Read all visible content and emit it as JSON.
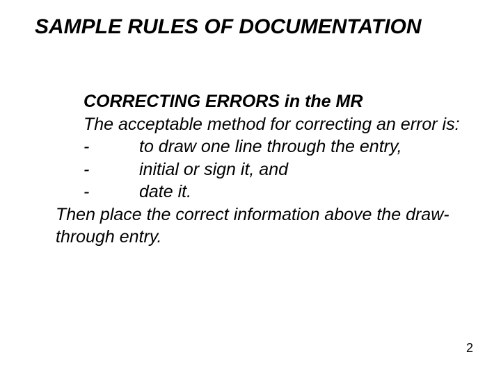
{
  "title": "SAMPLE RULES OF DOCUMENTATION",
  "subheading": "CORRECTING  ERRORS in the MR",
  "intro": "The acceptable method for correcting an error is:",
  "bullets": [
    " to draw one line through the entry,",
    "initial or sign it, and",
    "date it."
  ],
  "dash": "-",
  "closing": "Then place the correct information above the draw-through entry.",
  "page_number": "2"
}
